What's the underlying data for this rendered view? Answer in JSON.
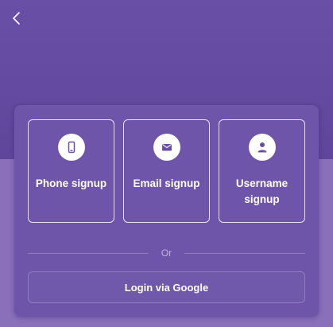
{
  "header": {
    "back_icon": "chevron-left-icon"
  },
  "signup_options": [
    {
      "label": "Phone signup",
      "icon": "phone-icon"
    },
    {
      "label": "Email signup",
      "icon": "envelope-icon"
    },
    {
      "label": "Username signup",
      "icon": "user-icon"
    }
  ],
  "divider": {
    "text": "Or"
  },
  "google_login": {
    "label": "Login via Google"
  },
  "colors": {
    "header_bg": "#654ba2",
    "page_bg": "#8a6fbb",
    "card_bg": "#6e55a9",
    "accent": "#6a4fa6",
    "text": "#ffffff"
  }
}
